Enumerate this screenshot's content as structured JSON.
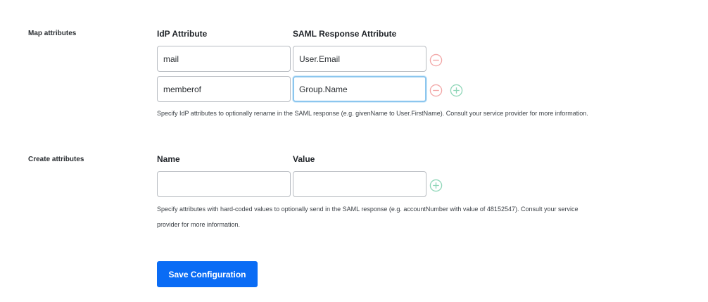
{
  "map_attributes": {
    "section_label": "Map attributes",
    "col_idp_header": "IdP Attribute",
    "col_saml_header": "SAML Response Attribute",
    "rows": [
      {
        "idp_value": "mail",
        "saml_value": "User.Email"
      },
      {
        "idp_value": "memberof",
        "saml_value": "Group.Name"
      }
    ],
    "help_text": "Specify IdP attributes to optionally rename in the SAML response (e.g. givenName to User.FirstName). Consult your service provider for more information."
  },
  "create_attributes": {
    "section_label": "Create attributes",
    "col_name_header": "Name",
    "col_value_header": "Value",
    "name_value": "",
    "value_value": "",
    "help_text_line1": "Specify attributes with hard-coded values to optionally send in the SAML response (e.g. accountNumber with value of 48152547). Consult your service",
    "help_text_line2": "provider for more information."
  },
  "save_button_label": "Save Configuration",
  "icons": {
    "remove": "minus-circle-icon",
    "add": "plus-circle-icon"
  },
  "colors": {
    "remove_icon": "#f2a6a6",
    "add_icon": "#8fd6b8",
    "focus_border": "#8cc6ee",
    "primary_button": "#0a6cf5"
  }
}
